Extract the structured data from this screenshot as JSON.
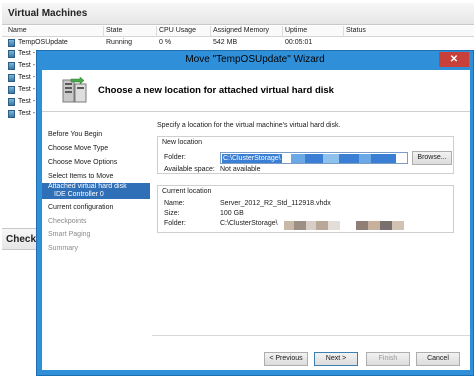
{
  "manager": {
    "title": "Virtual Machines",
    "checkpoints_title": "Checkpoints",
    "columns": [
      "Name",
      "State",
      "CPU Usage",
      "Assigned Memory",
      "Uptime",
      "Status"
    ],
    "rows": [
      {
        "name": "TempOSUpdate",
        "state": "Running",
        "cpu": "0 %",
        "memory": "542 MB",
        "uptime": "00:05:01",
        "status": ""
      },
      {
        "name": "Test -",
        "state": "",
        "cpu": "",
        "memory": "",
        "uptime": "",
        "status": ""
      },
      {
        "name": "Test -",
        "state": "",
        "cpu": "",
        "memory": "",
        "uptime": "",
        "status": ""
      },
      {
        "name": "Test -",
        "state": "",
        "cpu": "",
        "memory": "",
        "uptime": "",
        "status": ""
      },
      {
        "name": "Test -",
        "state": "",
        "cpu": "",
        "memory": "",
        "uptime": "",
        "status": ""
      },
      {
        "name": "Test -",
        "state": "",
        "cpu": "",
        "memory": "",
        "uptime": "",
        "status": ""
      },
      {
        "name": "Test -",
        "state": "",
        "cpu": "",
        "memory": "",
        "uptime": "",
        "status": ""
      }
    ]
  },
  "wizard": {
    "title": "Move \"TempOSUpdate\" Wizard",
    "close_label": "✕",
    "heading": "Choose a new location for attached virtual hard disk",
    "nav": [
      {
        "label": "Before You Begin",
        "state": "normal"
      },
      {
        "label": "Choose Move Type",
        "state": "normal"
      },
      {
        "label": "Choose Move Options",
        "state": "normal"
      },
      {
        "label": "Select Items to Move",
        "state": "normal"
      },
      {
        "label": "Current configuration",
        "state": "normal"
      },
      {
        "label": "Checkpoints",
        "state": "disabled"
      },
      {
        "label": "Smart Paging",
        "state": "disabled"
      },
      {
        "label": "Summary",
        "state": "disabled"
      }
    ],
    "nav_selected": {
      "line1": "Attached virtual hard disk",
      "line2": "IDE Controller 0"
    },
    "intro": "Specify a location for the virtual machine's virtual hard disk.",
    "new_location": {
      "title": "New location",
      "folder_label": "Folder:",
      "folder_value": "C:\\ClusterStorage\\",
      "browse_label": "Browse...",
      "available_label": "Available space:",
      "available_value": "Not available"
    },
    "current_location": {
      "title": "Current location",
      "name_label": "Name:",
      "name_value": "Server_2012_R2_Std_112918.vhdx",
      "size_label": "Size:",
      "size_value": "100 GB",
      "folder_label": "Folder:",
      "folder_value": "C:\\ClusterStorage\\"
    },
    "buttons": {
      "previous": "< Previous",
      "next": "Next >",
      "finish": "Finish",
      "cancel": "Cancel"
    }
  },
  "colors": {
    "accent": "#2f8fd8",
    "nav_selected": "#2f6fb8",
    "selection": "#3a7fd4",
    "close": "#c7403a"
  }
}
